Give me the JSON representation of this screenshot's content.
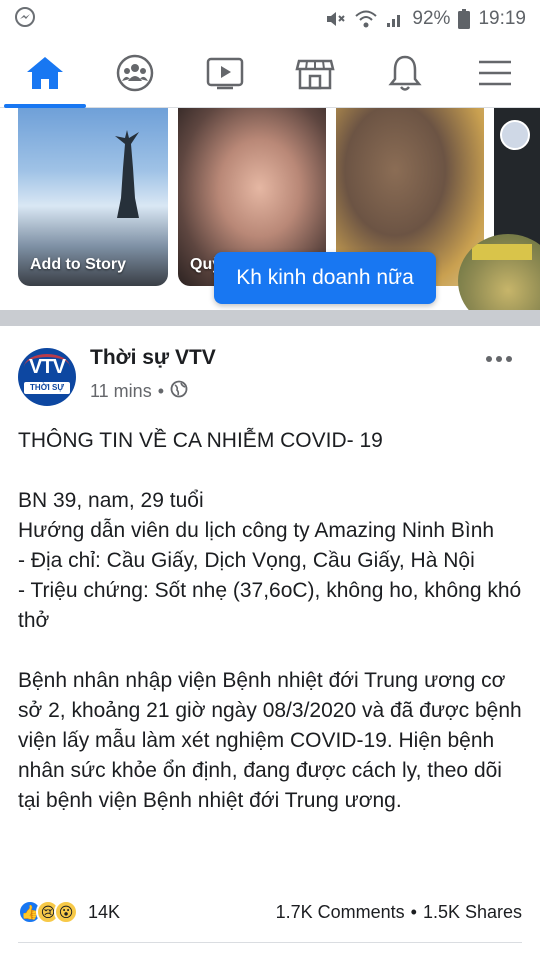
{
  "status_bar": {
    "battery": "92%",
    "time": "19:19"
  },
  "nav": {
    "items": [
      "home",
      "groups",
      "watch",
      "marketplace",
      "notifications",
      "menu"
    ],
    "active": "home"
  },
  "stories": {
    "items": [
      {
        "label": "Add to Story"
      },
      {
        "label": "Quỳ"
      },
      {
        "label": ""
      },
      {
        "label": ""
      }
    ]
  },
  "toast": {
    "text": "Kh kinh doanh nữa"
  },
  "post": {
    "author": "Thời sự VTV",
    "avatar_text": "VTV",
    "avatar_band": "THỜI SỰ",
    "time": "11 mins",
    "separator": "•",
    "lines": {
      "title": "THÔNG TIN VỀ CA NHIỄM COVID- 19",
      "case": "BN 39, nam, 29 tuổi",
      "job": "Hướng dẫn viên du lịch công ty Amazing Ninh Bình",
      "address": "- Địa chỉ: Cầu Giấy, Dịch Vọng, Cầu Giấy, Hà Nội",
      "symptoms": "- Triệu chứng: Sốt nhẹ (37,6oC), không ho, không khó thở",
      "details": "Bệnh nhân nhập viện Bệnh nhiệt đới Trung ương cơ sở 2, khoảng 21 giờ ngày 08/3/2020 và đã được bệnh viện lấy mẫu làm xét nghiệm COVID-19. Hiện bệnh nhân sức khỏe ổn định, đang được cách ly, theo dõi tại bệnh viện Bệnh nhiệt đới Trung ương."
    },
    "reactions": {
      "count": "14K",
      "comments": "1.7K Comments",
      "dot": "•",
      "shares": "1.5K Shares"
    }
  },
  "colors": {
    "accent": "#1877f2",
    "text": "#1c1e21",
    "muted": "#65676b"
  }
}
